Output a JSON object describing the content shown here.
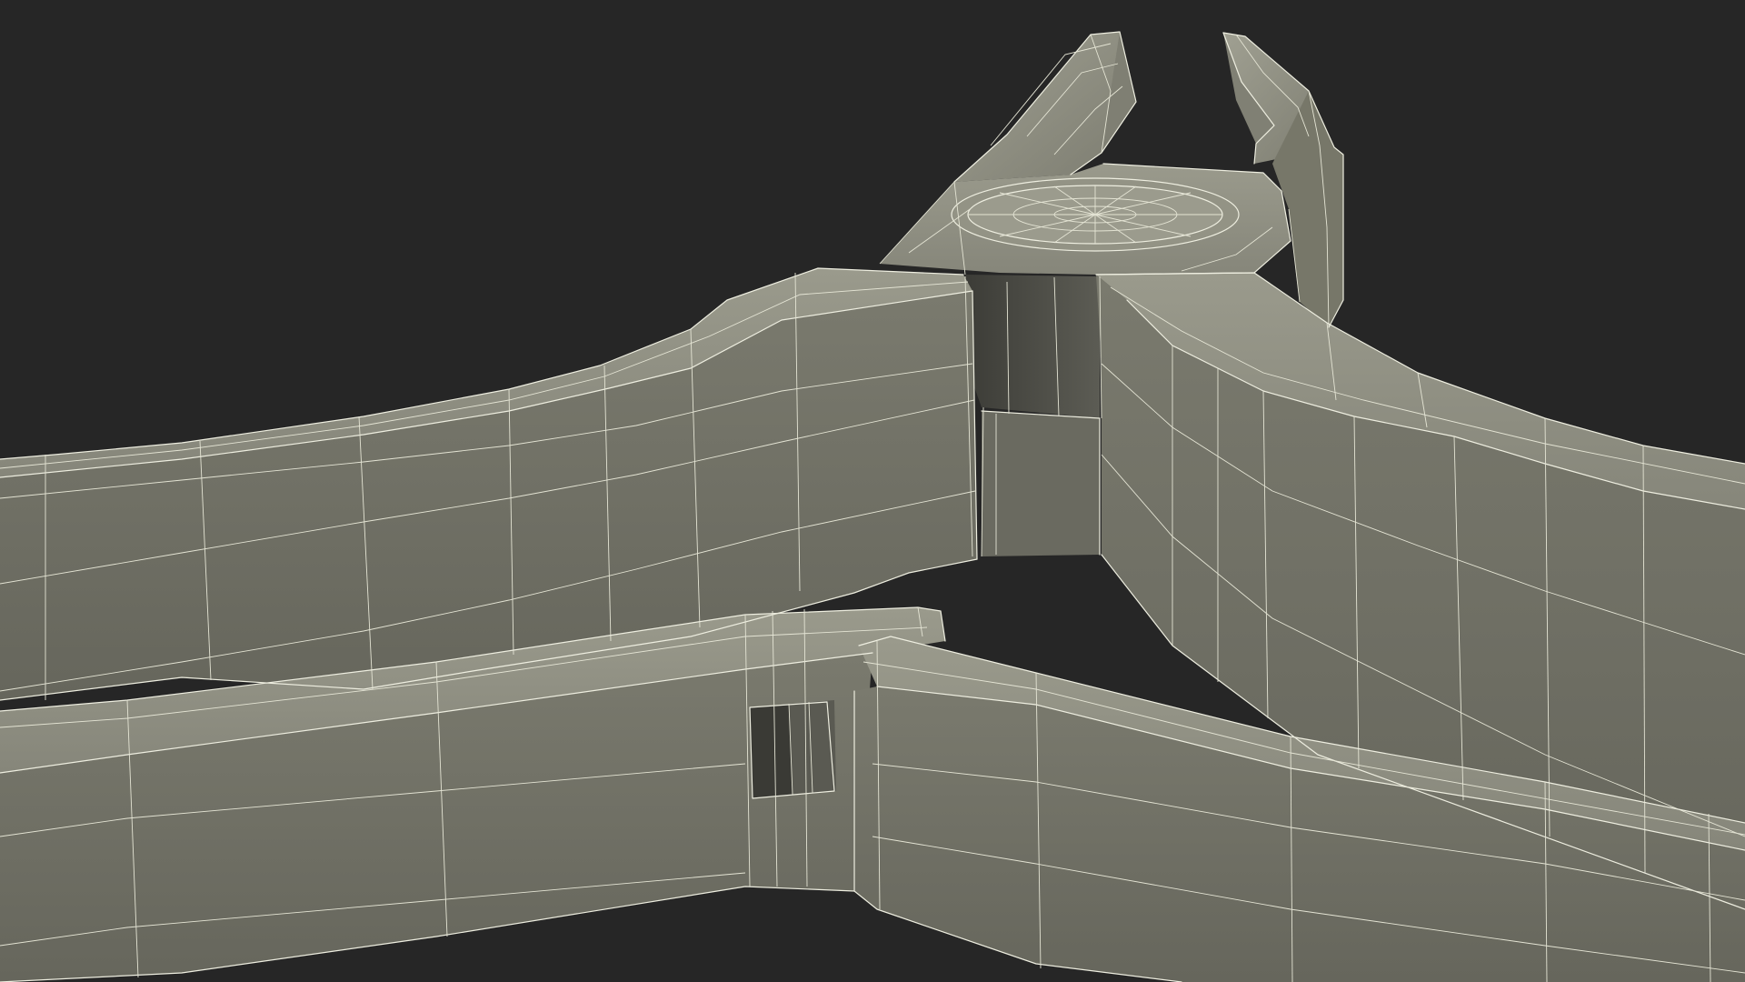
{
  "scene": {
    "subject": "pliers-wireframe-render",
    "display_mode": "shaded-wireframe",
    "colors": {
      "background": "#262626",
      "surface_top": "#8d8d80",
      "surface_side": "#6e6e63",
      "surface_shadow": "#4a4a44",
      "wireframe": "#eeeee0"
    }
  }
}
